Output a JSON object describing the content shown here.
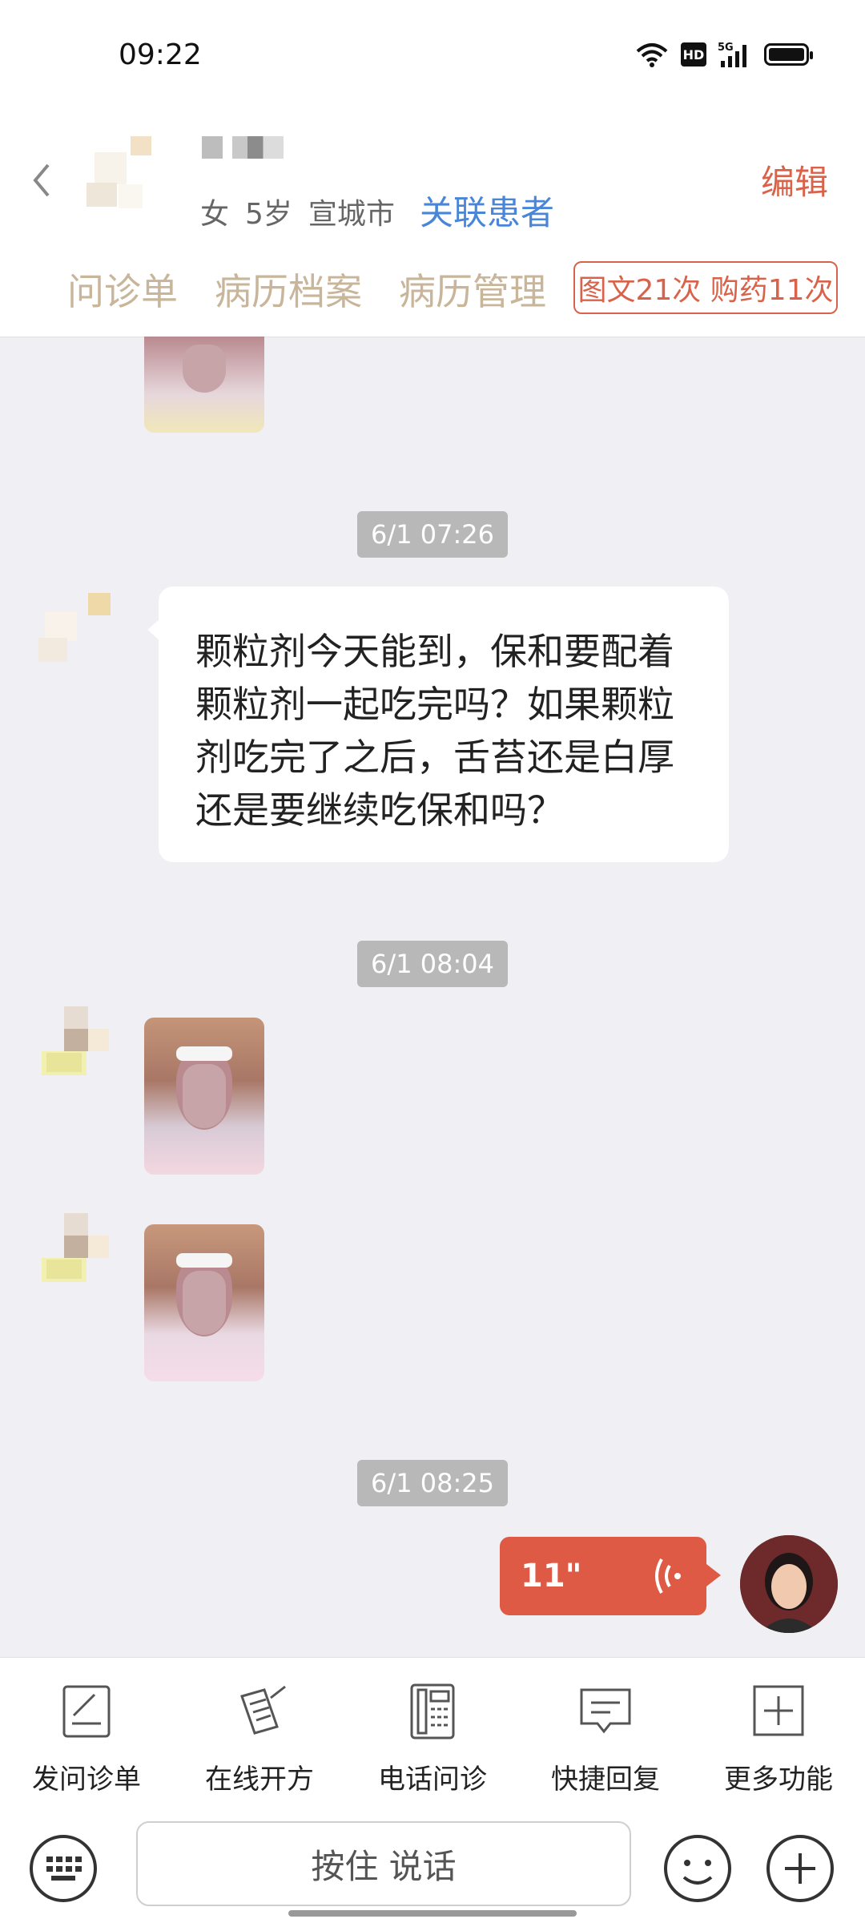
{
  "status_bar": {
    "time": "09:22",
    "hd_label": "HD",
    "network_label": "5G"
  },
  "header": {
    "patient_gender": "女",
    "patient_age": "5岁",
    "patient_city": "宣城市",
    "link_patient": "关联患者",
    "edit": "编辑",
    "tabs": [
      "问诊单",
      "病历档案",
      "病历管理"
    ],
    "stats_badge": "图文21次 购药11次"
  },
  "messages": {
    "time_1": "6/1 07:26",
    "text_1": "颗粒剂今天能到，保和要配着颗粒剂一起吃完吗？如果颗粒剂吃完了之后，舌苔还是白厚还是要继续吃保和吗？",
    "time_2": "6/1 08:04",
    "time_3": "6/1 08:25",
    "voice_duration": "11\""
  },
  "toolbar": {
    "items": [
      {
        "label": "发问诊单",
        "icon": "form-icon"
      },
      {
        "label": "在线开方",
        "icon": "prescription-icon"
      },
      {
        "label": "电话问诊",
        "icon": "phone-icon"
      },
      {
        "label": "快捷回复",
        "icon": "quick-reply-icon"
      },
      {
        "label": "更多功能",
        "icon": "more-icon"
      }
    ]
  },
  "input_bar": {
    "hold_to_talk": "按住 说话"
  },
  "colors": {
    "accent": "#df5a44",
    "link": "#4a86d8",
    "tab_text": "#c8b59a",
    "chat_bg": "#efeff4"
  }
}
